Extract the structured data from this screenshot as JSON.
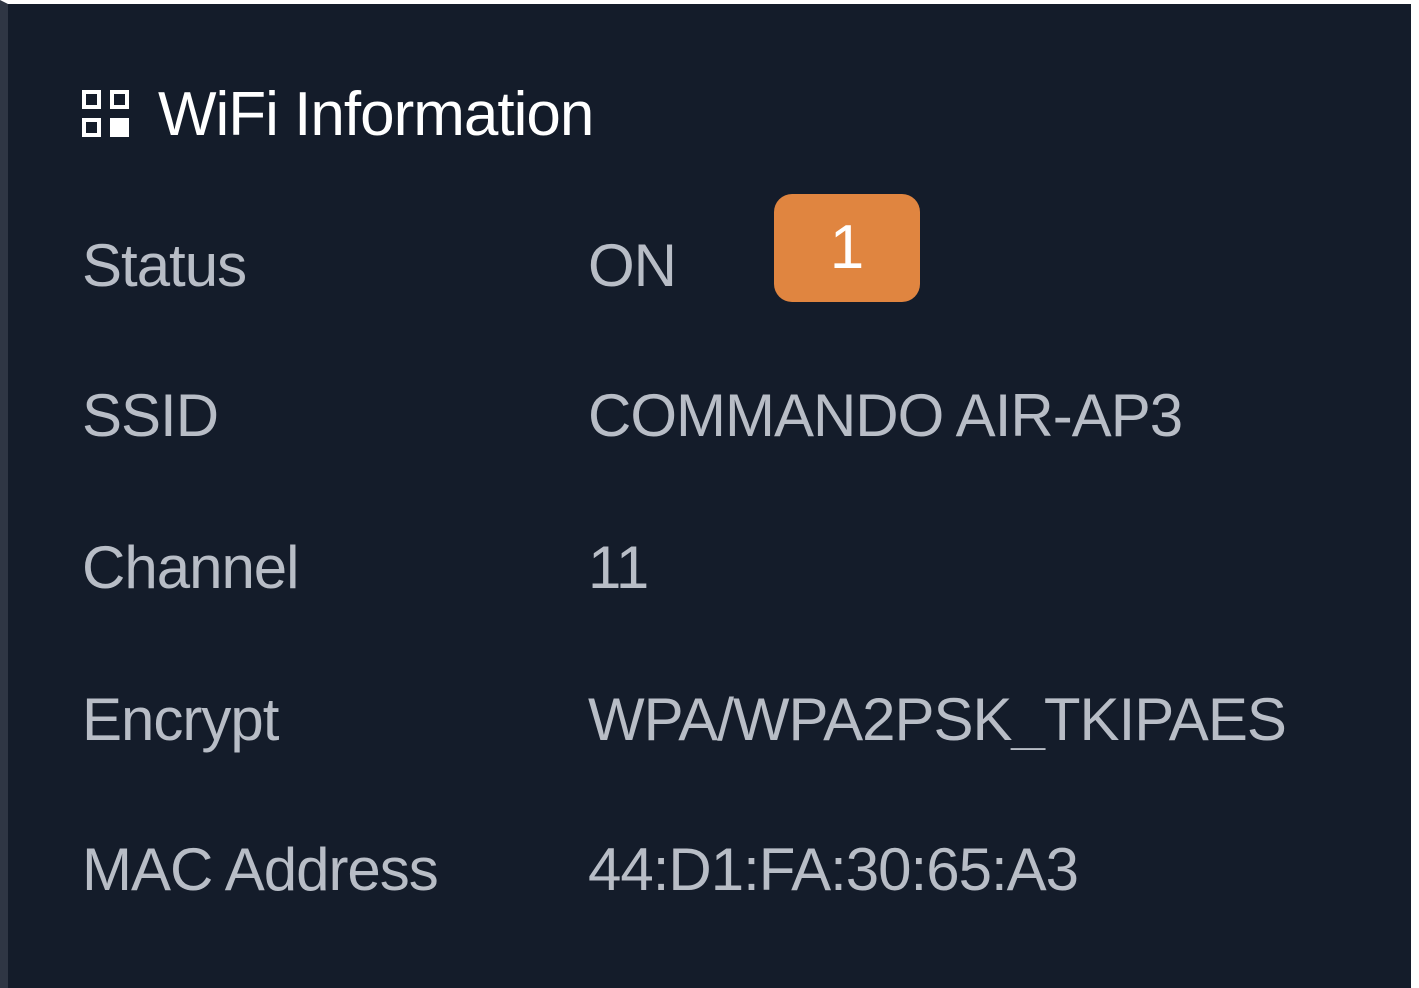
{
  "panel": {
    "title": "WiFi Information",
    "title_icon": "grid-icon",
    "badge": "1",
    "badge_color": "#e08540",
    "background_color": "#141c2a"
  },
  "rows": [
    {
      "label": "Status",
      "value": "ON"
    },
    {
      "label": "SSID",
      "value": "COMMANDO AIR-AP3"
    },
    {
      "label": "Channel",
      "value": "11"
    },
    {
      "label": "Encrypt",
      "value": "WPA/WPA2PSK_TKIPAES"
    },
    {
      "label": "MAC Address",
      "value": "44:D1:FA:30:65:A3"
    }
  ]
}
